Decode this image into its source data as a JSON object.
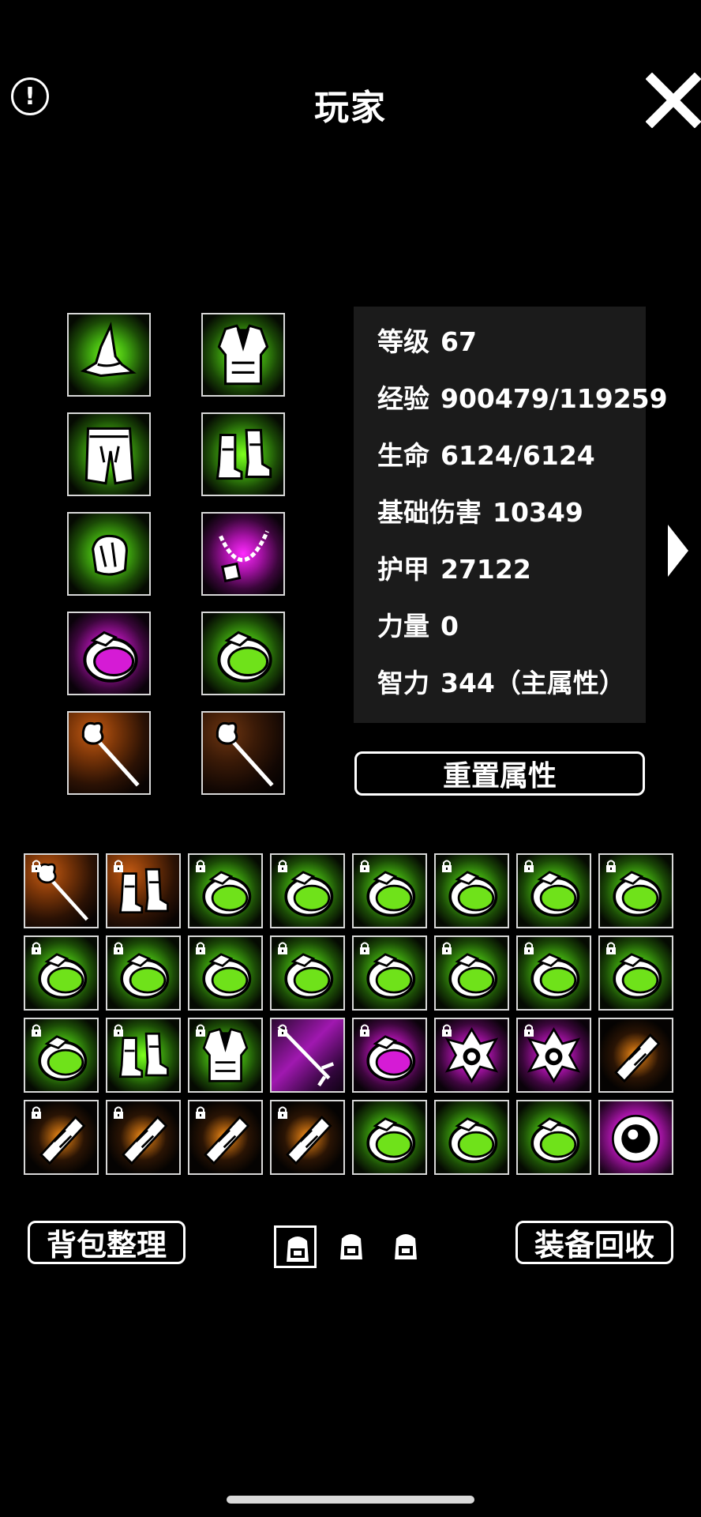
{
  "header": {
    "title": "玩家",
    "info_icon": "!"
  },
  "equipment": [
    {
      "name": "wizard-hat",
      "rarity": "green"
    },
    {
      "name": "robe",
      "rarity": "green"
    },
    {
      "name": "pants",
      "rarity": "green"
    },
    {
      "name": "boots",
      "rarity": "green"
    },
    {
      "name": "gloves",
      "rarity": "green"
    },
    {
      "name": "necklace",
      "rarity": "purple"
    },
    {
      "name": "ring",
      "rarity": "purple"
    },
    {
      "name": "ring",
      "rarity": "green"
    },
    {
      "name": "staff",
      "rarity": "orange"
    },
    {
      "name": "staff",
      "rarity": "dark-orange"
    }
  ],
  "stats": [
    {
      "label": "等级",
      "value": "67"
    },
    {
      "label": "经验",
      "value": "900479/119259"
    },
    {
      "label": "生命",
      "value": "6124/6124"
    },
    {
      "label": "基础伤害",
      "value": "10349"
    },
    {
      "label": "护甲",
      "value": "27122"
    },
    {
      "label": "力量",
      "value": "0"
    },
    {
      "label": "智力",
      "value": "344（主属性）"
    }
  ],
  "buttons": {
    "reset": "重置属性",
    "sort_bag": "背包整理",
    "recycle": "装备回收"
  },
  "inventory": [
    {
      "item": "staff",
      "rarity": "orange",
      "locked": true
    },
    {
      "item": "boots",
      "rarity": "orange",
      "locked": true
    },
    {
      "item": "ring",
      "rarity": "green",
      "locked": true
    },
    {
      "item": "ring",
      "rarity": "green",
      "locked": true
    },
    {
      "item": "ring",
      "rarity": "green",
      "locked": true
    },
    {
      "item": "ring",
      "rarity": "green",
      "locked": true
    },
    {
      "item": "ring",
      "rarity": "green",
      "locked": true
    },
    {
      "item": "ring",
      "rarity": "green",
      "locked": true
    },
    {
      "item": "ring",
      "rarity": "green",
      "locked": true
    },
    {
      "item": "ring",
      "rarity": "green",
      "locked": true
    },
    {
      "item": "ring",
      "rarity": "green",
      "locked": true
    },
    {
      "item": "ring",
      "rarity": "green",
      "locked": true
    },
    {
      "item": "ring",
      "rarity": "green",
      "locked": true
    },
    {
      "item": "ring",
      "rarity": "green",
      "locked": true
    },
    {
      "item": "ring",
      "rarity": "green",
      "locked": true
    },
    {
      "item": "ring",
      "rarity": "green",
      "locked": true
    },
    {
      "item": "ring",
      "rarity": "green",
      "locked": true
    },
    {
      "item": "boots",
      "rarity": "green",
      "locked": true
    },
    {
      "item": "robe",
      "rarity": "green",
      "locked": true
    },
    {
      "item": "sword",
      "rarity": "purple-diag",
      "locked": true
    },
    {
      "item": "ring",
      "rarity": "purple",
      "locked": true
    },
    {
      "item": "amulet",
      "rarity": "purple",
      "locked": true
    },
    {
      "item": "amulet",
      "rarity": "purple",
      "locked": true
    },
    {
      "item": "scroll",
      "rarity": "orange-spot",
      "locked": false
    },
    {
      "item": "scroll",
      "rarity": "orange-spot",
      "locked": true
    },
    {
      "item": "scroll",
      "rarity": "orange-spot",
      "locked": true
    },
    {
      "item": "scroll",
      "rarity": "orange-spot",
      "locked": true
    },
    {
      "item": "scroll",
      "rarity": "orange-spot",
      "locked": true
    },
    {
      "item": "ring",
      "rarity": "green",
      "locked": false
    },
    {
      "item": "ring",
      "rarity": "green",
      "locked": false
    },
    {
      "item": "ring",
      "rarity": "green",
      "locked": false
    },
    {
      "item": "orb",
      "rarity": "purple-wide",
      "locked": false
    }
  ],
  "bag_pages": [
    {
      "name": "bag-page-1",
      "selected": true
    },
    {
      "name": "bag-page-2",
      "selected": false
    },
    {
      "name": "bag-page-3",
      "selected": false
    }
  ]
}
